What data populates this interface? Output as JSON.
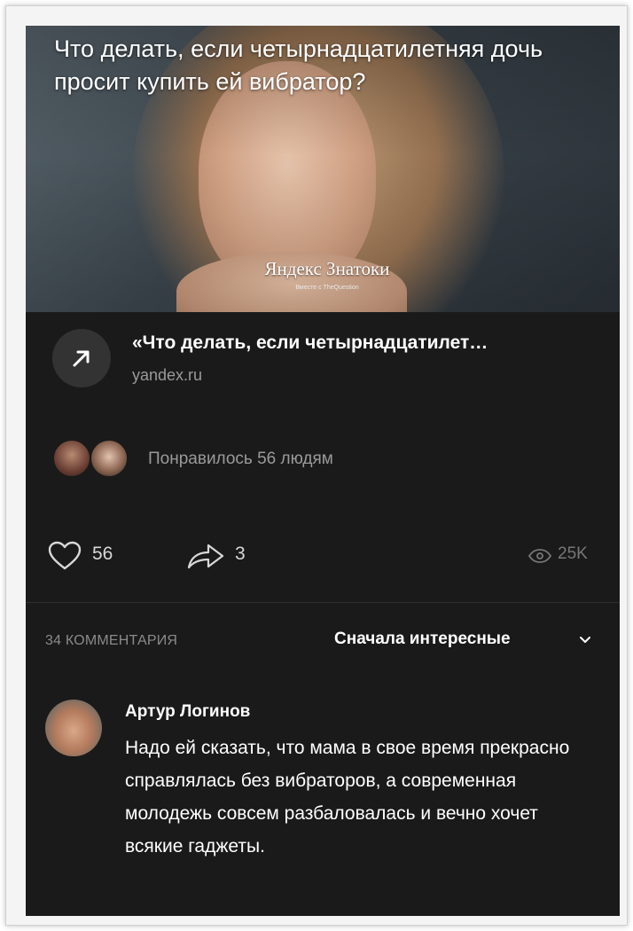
{
  "post": {
    "title": "Что делать, если четырнадцатилетняя дочь просит купить ей вибратор?",
    "brand": "Яндекс Знатоки",
    "brand_subtitle": "Вместе с TheQuestion"
  },
  "link": {
    "title": "«Что делать, если четырнадцатилет…",
    "domain": "yandex.ru",
    "icon": "arrow-up-right-icon"
  },
  "likes": {
    "text": "Понравилось 56 людям"
  },
  "actions": {
    "likes": "56",
    "shares": "3",
    "views": "25K"
  },
  "comments": {
    "count_label": "34 КОММЕНТАРИЯ",
    "sort_label": "Сначала интересные",
    "items": [
      {
        "author": "Артур Логинов",
        "text": "Надо ей сказать, что мама в свое время прекрасно справлялась без вибраторов, а современная молодежь совсем разбаловалась и вечно хочет всякие гаджеты."
      }
    ]
  },
  "colors": {
    "background": "#1a1a1a",
    "text_primary": "#ffffff",
    "text_secondary": "#9a9a9a"
  }
}
